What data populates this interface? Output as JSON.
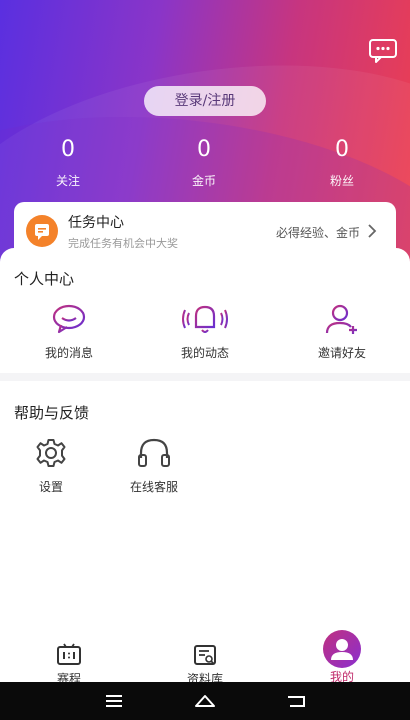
{
  "header": {
    "login_label": "登录/注册",
    "stats": [
      {
        "value": "0",
        "label": "关注"
      },
      {
        "value": "0",
        "label": "金币"
      },
      {
        "value": "0",
        "label": "粉丝"
      }
    ]
  },
  "task": {
    "title": "任务中心",
    "subtitle": "完成任务有机会中大奖",
    "reward": "必得经验、金币"
  },
  "personal": {
    "title": "个人中心",
    "items": [
      {
        "label": "我的消息",
        "icon": "chat-bubble-icon"
      },
      {
        "label": "我的动态",
        "icon": "bell-icon"
      },
      {
        "label": "邀请好友",
        "icon": "add-user-icon"
      }
    ]
  },
  "help": {
    "title": "帮助与反馈",
    "items": [
      {
        "label": "设置",
        "icon": "gear-icon"
      },
      {
        "label": "在线客服",
        "icon": "headset-icon"
      }
    ]
  },
  "tabs": [
    {
      "label": "赛程",
      "icon": "scoreboard-icon"
    },
    {
      "label": "资料库",
      "icon": "database-icon"
    },
    {
      "label": "我的",
      "icon": "avatar-icon",
      "active": true
    }
  ],
  "colors": {
    "accent": "#c02a6a",
    "gradient_start": "#5a2fe0",
    "gradient_end": "#f0404c",
    "task_icon": "#f4822a",
    "icon_purple": "#7a3cc8"
  }
}
